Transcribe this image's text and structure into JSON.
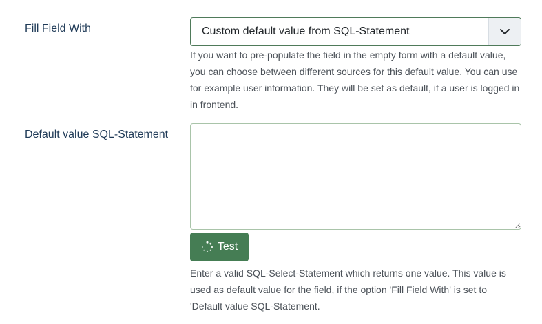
{
  "fill_field": {
    "label": "Fill Field With",
    "selected_value": "Custom default value from SQL-Statement",
    "caret_icon": "chevron-down-icon",
    "help_text": "If you want to pre-populate the field in the empty form with a default value, you can choose between different sources for this default value. You can use for example user information. They will be set as default, if a user is logged in in frontend."
  },
  "default_sql": {
    "label": "Default value SQL-Statement",
    "value": "",
    "test_button": {
      "label": "Test",
      "icon": "spinner-icon"
    },
    "help_text": "Enter a valid SQL-Select-Statement which returns one value. This value is used as default value for the field, if the option 'Fill Field With' is set to 'Default value SQL-Statement."
  },
  "colors": {
    "accent": "#457d54",
    "label": "#1f3a57"
  }
}
